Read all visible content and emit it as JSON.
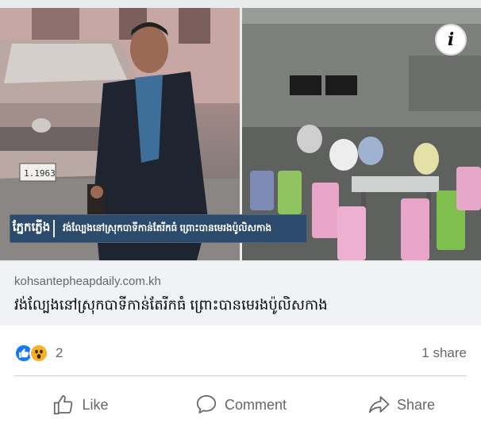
{
  "media": {
    "caption_brand": "ភ្នែកភ្លើង",
    "caption_text": "វង់ល្បែងនៅស្រុកបាទីកាន់តែរីកធំ ព្រោះបានមេរងប៉ូលិសកាង",
    "info_icon": "info-icon",
    "plate_text": "1.1963"
  },
  "link": {
    "domain": "kohsantepheapdaily.com.kh",
    "title": "វង់ល្បែងនៅស្រុកបាទីកាន់តែរីកធំ ព្រោះបានមេរងប៉ូលិសកាង"
  },
  "reactions": {
    "icons": [
      "like-icon",
      "wow-icon"
    ],
    "count": "2",
    "shares": "1 share"
  },
  "actions": {
    "like": "Like",
    "comment": "Comment",
    "share": "Share"
  },
  "colors": {
    "like_blue": "#1877f2",
    "wow_yellow": "#f7b125",
    "muted_text": "#65676b",
    "link_bg": "#f0f2f5",
    "banner_bg": "#2c4a6b"
  }
}
